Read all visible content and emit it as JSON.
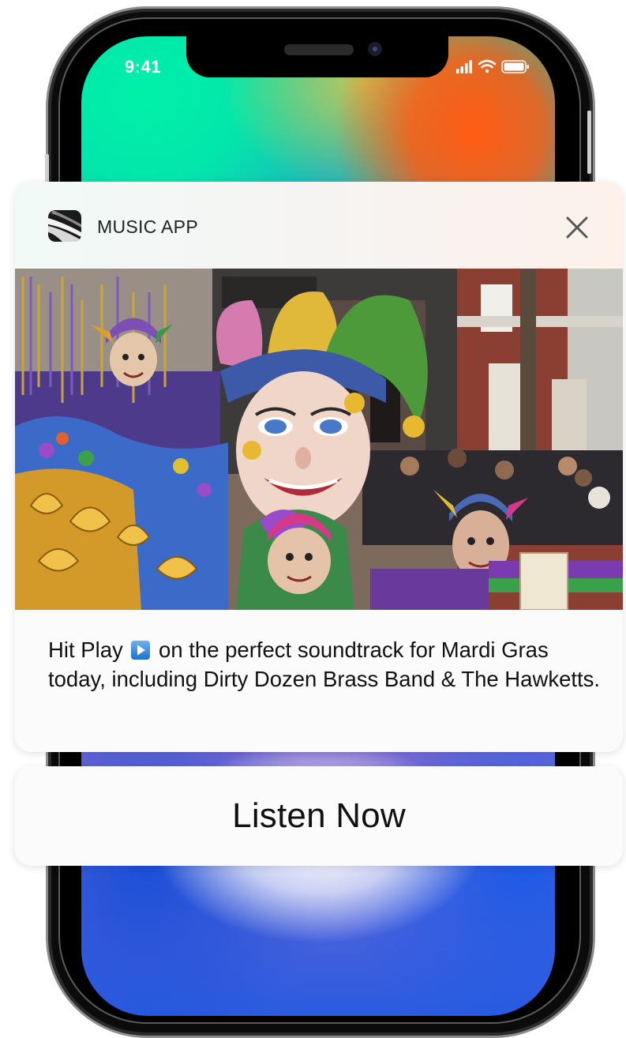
{
  "status_bar": {
    "time": "9:41",
    "icons": [
      "cellular-signal-icon",
      "wifi-icon",
      "battery-icon"
    ]
  },
  "notification": {
    "app_name": "MUSIC APP",
    "app_icon": "music-app-icon",
    "close_icon": "close-icon",
    "image": "mardi-gras-parade-jester-float",
    "message_before_icon": "Hit Play",
    "message_icon": "play-button-icon",
    "message_after_icon": "on the perfect soundtrack for Mardi Gras today, including Dirty Dozen Brass Band & The Hawketts."
  },
  "action": {
    "label": "Listen Now"
  },
  "colors": {
    "card_bg": "#fbfbfc",
    "play_icon_blue": "#2f7fd8",
    "wallpaper_green": "#00f0a8",
    "wallpaper_orange": "#ff5a12",
    "wallpaper_blue": "#1a4fd8"
  }
}
